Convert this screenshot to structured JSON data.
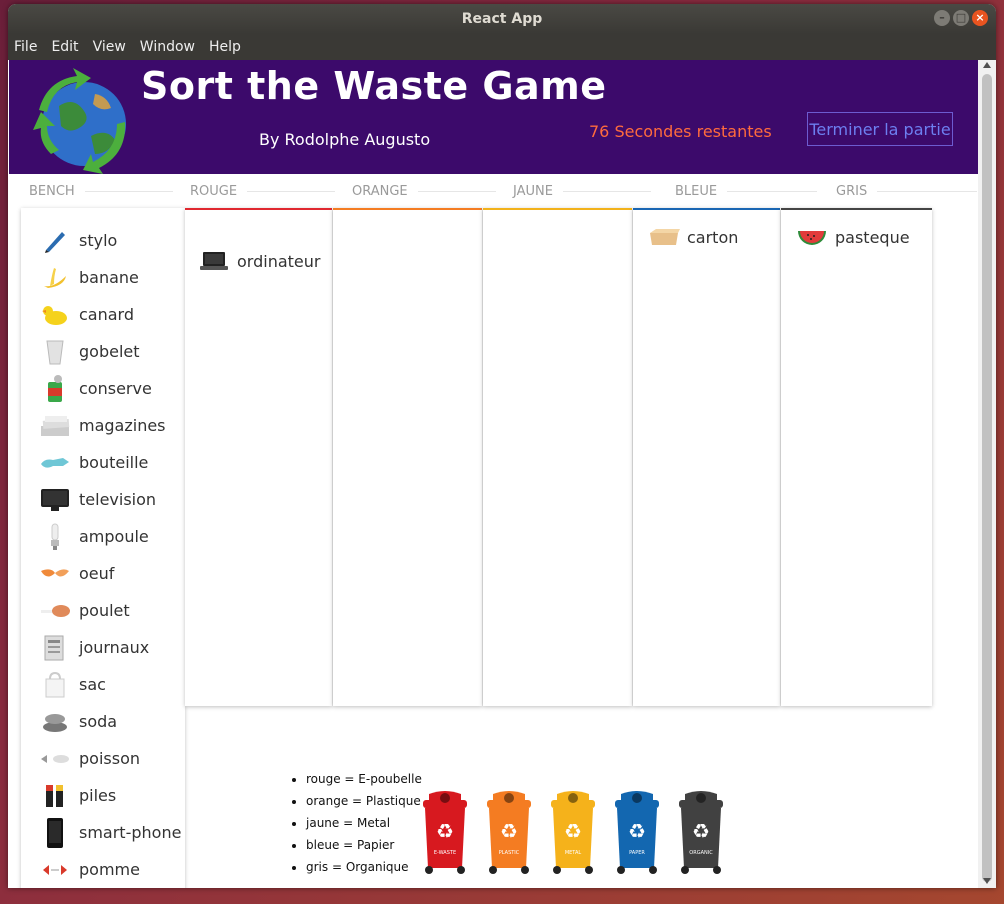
{
  "window": {
    "title": "React App"
  },
  "menu": [
    "File",
    "Edit",
    "Window",
    "Help"
  ],
  "menu_full": [
    "File",
    "Edit",
    "View",
    "Window",
    "Help"
  ],
  "header": {
    "title": "Sort the Waste Game",
    "author": "By Rodolphe Augusto",
    "timer": "76 Secondes restantes",
    "end_button": "Terminer la partie"
  },
  "columns": [
    "BENCH",
    "ROUGE",
    "ORANGE",
    "JAUNE",
    "BLEUE",
    "GRIS"
  ],
  "column_colors": [
    "#ffffff",
    "#e0282f",
    "#f47c22",
    "#f2b21b",
    "#1a66b3",
    "#444444"
  ],
  "bench_items": [
    {
      "label": "stylo",
      "icon": "pen-icon"
    },
    {
      "label": "banane",
      "icon": "banana-icon"
    },
    {
      "label": "canard",
      "icon": "duck-icon"
    },
    {
      "label": "gobelet",
      "icon": "cup-icon"
    },
    {
      "label": "conserve",
      "icon": "can-icon"
    },
    {
      "label": "magazines",
      "icon": "magazines-icon"
    },
    {
      "label": "bouteille",
      "icon": "bottle-icon"
    },
    {
      "label": "television",
      "icon": "tv-icon"
    },
    {
      "label": "ampoule",
      "icon": "bulb-icon"
    },
    {
      "label": "oeuf",
      "icon": "egg-icon"
    },
    {
      "label": "poulet",
      "icon": "chicken-icon"
    },
    {
      "label": "journaux",
      "icon": "newspaper-icon"
    },
    {
      "label": "sac",
      "icon": "bag-icon"
    },
    {
      "label": "soda",
      "icon": "soda-icon"
    },
    {
      "label": "poisson",
      "icon": "fish-icon"
    },
    {
      "label": "piles",
      "icon": "batteries-icon"
    },
    {
      "label": "smart-phone",
      "icon": "phone-icon"
    },
    {
      "label": "pomme",
      "icon": "apple-icon"
    }
  ],
  "bins": {
    "rouge": [
      {
        "label": "ordinateur",
        "icon": "laptop-icon"
      }
    ],
    "orange": [],
    "jaune": [],
    "bleue": [
      {
        "label": "carton",
        "icon": "box-icon"
      }
    ],
    "gris": [
      {
        "label": "pasteque",
        "icon": "watermelon-icon"
      }
    ]
  },
  "legend": [
    "rouge = E-poubelle",
    "orange = Plastique",
    "jaune = Metal",
    "bleue = Papier",
    "gris = Organique"
  ],
  "cans": [
    {
      "label": "E-WASTE",
      "color": "#d7191f"
    },
    {
      "label": "PLASTIC",
      "color": "#f47c22"
    },
    {
      "label": "METAL",
      "color": "#f5b21b"
    },
    {
      "label": "PAPER",
      "color": "#1367b0"
    },
    {
      "label": "ORGANIC",
      "color": "#414141"
    }
  ]
}
